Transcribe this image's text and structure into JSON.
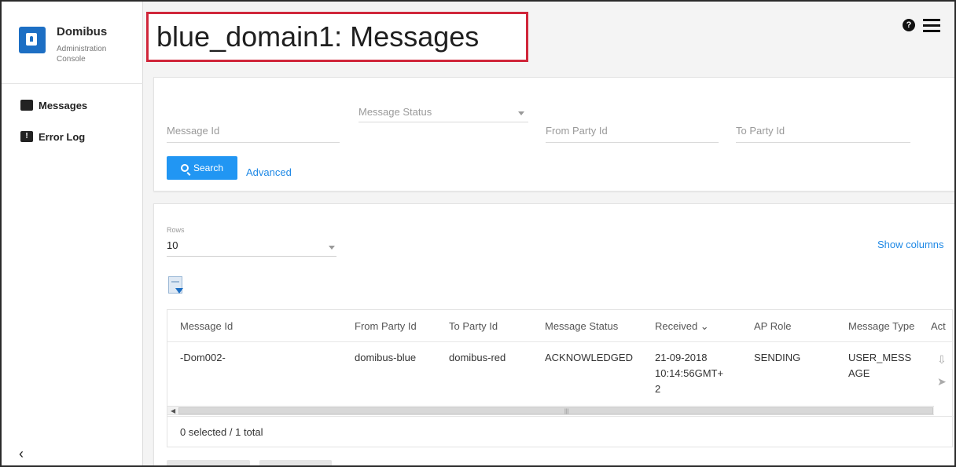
{
  "brand": {
    "name": "Domibus",
    "subtitle": "Administration Console"
  },
  "sidebar": {
    "items": [
      {
        "label": "Messages",
        "icon": "message-icon"
      },
      {
        "label": "Error Log",
        "icon": "error-log-icon"
      }
    ],
    "collapse_label": "‹"
  },
  "header": {
    "title": "blue_domain1: Messages",
    "help_icon": "?"
  },
  "filters": {
    "message_id_placeholder": "Message Id",
    "message_status_placeholder": "Message Status",
    "from_party_placeholder": "From Party Id",
    "to_party_placeholder": "To Party Id",
    "search_label": "Search",
    "advanced_label": "Advanced"
  },
  "results": {
    "rows_label": "Rows",
    "rows_value": "10",
    "show_columns_label": "Show columns",
    "columns": [
      "Message Id",
      "From Party Id",
      "To Party Id",
      "Message Status",
      "Received ⌄",
      "AP Role",
      "Message Type",
      "Act"
    ],
    "rows": [
      {
        "message_id": "-Dom002-",
        "from_party": "domibus-blue",
        "to_party": "domibus-red",
        "status": "ACKNOWLEDGED",
        "received": "21-09-2018 10:14:56GMT+ 2",
        "ap_role": "SENDING",
        "message_type": "USER_MESS AGE"
      }
    ],
    "summary": "0 selected / 1 total"
  },
  "colors": {
    "accent": "#2196f3",
    "title_highlight": "#d0263a",
    "brand": "#1d6fc4"
  }
}
